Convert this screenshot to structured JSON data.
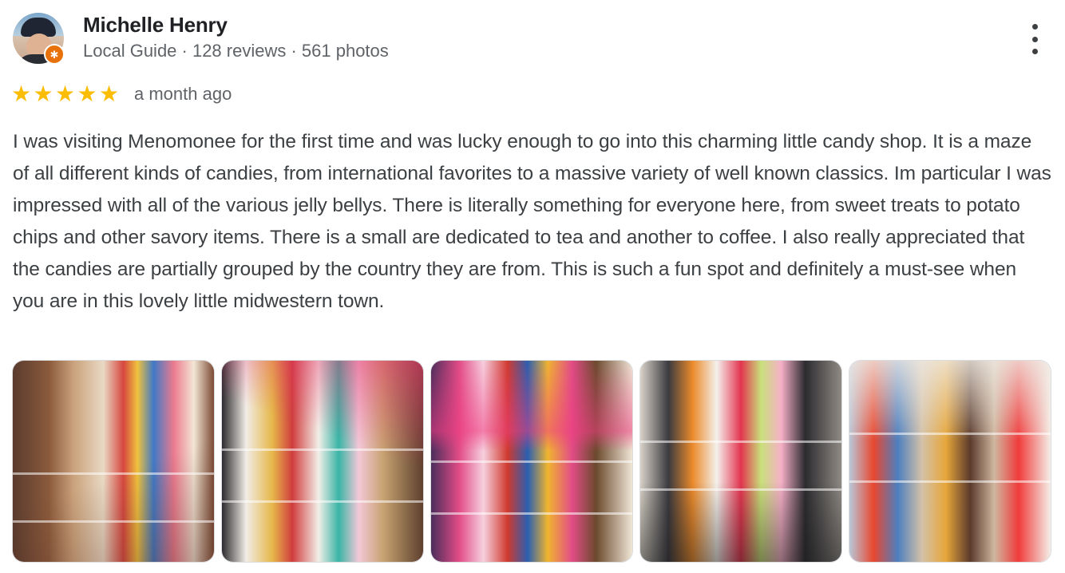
{
  "reviewer": {
    "name": "Michelle Henry",
    "meta": "Local Guide · 128 reviews · 561 photos",
    "badge_icon": "local-guide-star-icon"
  },
  "review": {
    "rating": 5,
    "rating_max": 5,
    "star_color": "#fbbc04",
    "date": "a month ago",
    "text": "I was visiting Menomonee for the first time and was lucky enough to go into this charming little candy shop. It is a maze of all different kinds of candies, from international favorites to a massive variety of well known classics. Im particular I was impressed with all of the various jelly bellys. There is literally something for everyone here, from sweet treats to potato chips and other savory items. There is a small are dedicated to tea and another to coffee. I also really appreciated that the candies are partially grouped by the country they are from. This is such a fun spot and definitely a must-see when you are in this lovely little midwestern town."
  },
  "photos": {
    "count": 5
  },
  "actions": {
    "more_icon": "more-vert-icon"
  },
  "colors": {
    "name": "#202124",
    "secondary": "#5f6368",
    "body": "#3c4043",
    "badge": "#e8710a"
  }
}
